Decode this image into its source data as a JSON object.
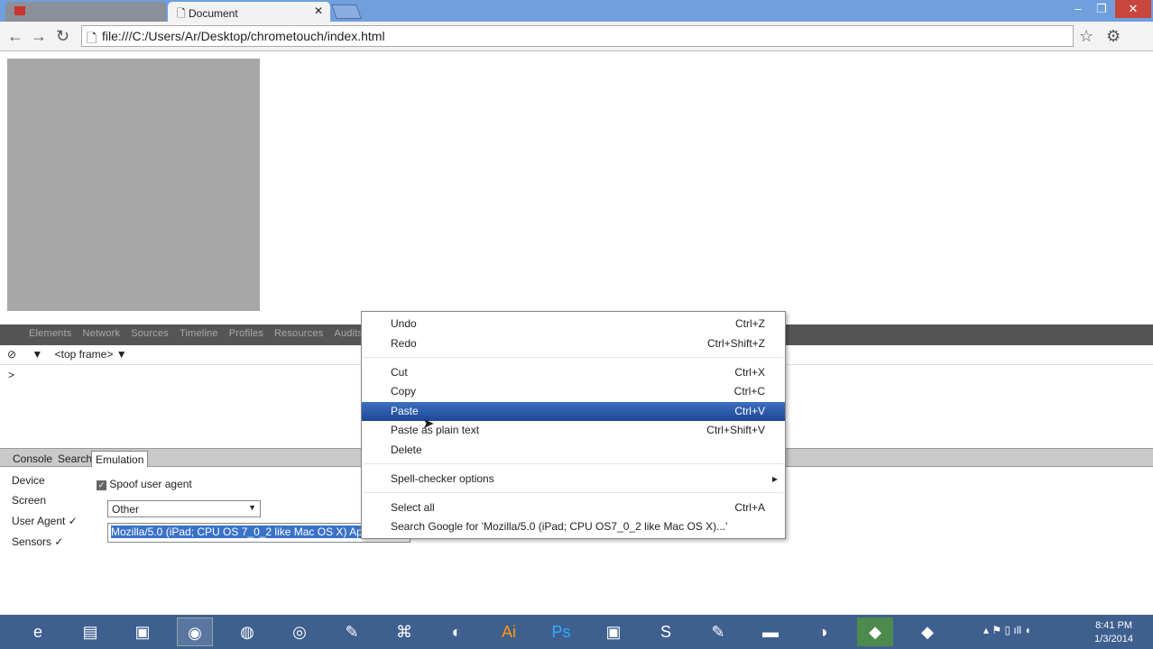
{
  "browser": {
    "active_tab": "Document",
    "url": "file:///C:/Users/Ar/Desktop/chrometouch/index.html"
  },
  "devtools": {
    "panels": [
      "Elements",
      "Network",
      "Sources",
      "Timeline",
      "Profiles",
      "Resources",
      "Audits"
    ],
    "frame_selector": "<top frame>",
    "prompt": ">",
    "drawer_tabs": [
      "Console",
      "Search",
      "Emulation"
    ],
    "emulation": {
      "sections": [
        "Device",
        "Screen",
        "User Agent ✓",
        "Sensors ✓"
      ],
      "spoof_label": "Spoof user agent",
      "spoof_checked": true,
      "ua_select": "Other",
      "ua_value": "Mozilla/5.0 (iPad; CPU OS 7_0_2 like Mac OS X) AppleWe"
    }
  },
  "context_menu": {
    "items": [
      {
        "label": "Undo",
        "shortcut": "Ctrl+Z"
      },
      {
        "label": "Redo",
        "shortcut": "Ctrl+Shift+Z"
      },
      {
        "label": "Cut",
        "shortcut": "Ctrl+X"
      },
      {
        "label": "Copy",
        "shortcut": "Ctrl+C"
      },
      {
        "label": "Paste",
        "shortcut": "Ctrl+V",
        "highlighted": true
      },
      {
        "label": "Paste as plain text",
        "shortcut": "Ctrl+Shift+V"
      },
      {
        "label": "Delete",
        "shortcut": ""
      },
      {
        "label": "Spell-checker options",
        "shortcut": "▸"
      },
      {
        "label": "Select all",
        "shortcut": "Ctrl+A"
      },
      {
        "label": "Search Google for 'Mozilla/5.0 (iPad; CPU OS7_0_2 like Mac OS X)...'",
        "shortcut": ""
      }
    ]
  },
  "taskbar": {
    "icons": [
      "ie",
      "file-explorer",
      "app",
      "chrome",
      "firefox",
      "chrome-canary",
      "paint",
      "xampp",
      "globe",
      "illustrator",
      "photoshop",
      "app",
      "skype",
      "paint",
      "cmd",
      "network",
      "app",
      "app"
    ],
    "time": "8:41 PM",
    "date": "1/3/2014"
  },
  "colors": {
    "highlight": "#2a5aab",
    "tabbar": "#6f9fdc",
    "taskbar": "#3f5f8f"
  }
}
